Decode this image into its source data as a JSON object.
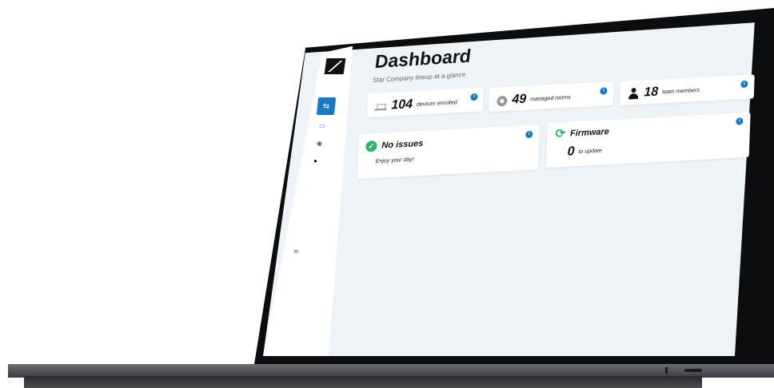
{
  "page": {
    "title": "Dashboard",
    "subtitle": "Star Company lineup at a glance"
  },
  "stats": [
    {
      "value": "104",
      "label": "devices enrolled",
      "icon": "device-icon"
    },
    {
      "value": "49",
      "label": "managed rooms",
      "icon": "room-icon"
    },
    {
      "value": "18",
      "label": "team members",
      "icon": "user-icon"
    }
  ],
  "issues_card": {
    "title": "No issues",
    "message": "Enjoy your day!",
    "icon": "check-circle-icon"
  },
  "firmware_card": {
    "title": "Firmware",
    "count": "0",
    "label": "to update",
    "icon": "refresh-icon"
  },
  "sidebar": {
    "expand_glyph": "»",
    "items": [
      "dashboard-icon",
      "device-icon",
      "room-icon",
      "user-icon"
    ]
  },
  "colors": {
    "accent": "#1a78c2",
    "success": "#2db56d",
    "background": "#eef3f7"
  }
}
